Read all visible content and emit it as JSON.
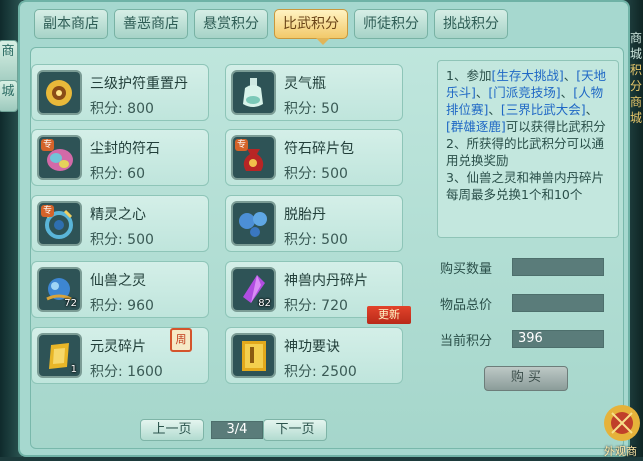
{
  "side_left": {
    "glyph_top": "商",
    "glyph_bottom": "城"
  },
  "side_right": {
    "glyphs": [
      "商",
      "城",
      "积",
      "分",
      "商",
      "城"
    ]
  },
  "tabs": [
    {
      "label": "副本商店",
      "active": false
    },
    {
      "label": "善恶商店",
      "active": false
    },
    {
      "label": "悬赏积分",
      "active": false
    },
    {
      "label": "比武积分",
      "active": true
    },
    {
      "label": "师徒积分",
      "active": false
    },
    {
      "label": "挑战积分",
      "active": false
    }
  ],
  "items": [
    {
      "name": "三级护符重置丹",
      "price": "积分: 800",
      "icon": "amulet-reset-pill-icon"
    },
    {
      "name": "灵气瓶",
      "price": "积分: 50",
      "icon": "spirit-bottle-icon"
    },
    {
      "name": "尘封的符石",
      "price": "积分: 60",
      "icon": "sealed-runestone-icon",
      "badge": "专"
    },
    {
      "name": "符石碎片包",
      "price": "积分: 500",
      "icon": "runestone-fragment-bag-icon",
      "badge": "专"
    },
    {
      "name": "精灵之心",
      "price": "积分: 500",
      "icon": "spirit-heart-icon",
      "badge": "专"
    },
    {
      "name": "脱胎丹",
      "price": "积分: 500",
      "icon": "rebirth-pill-icon"
    },
    {
      "name": "仙兽之灵",
      "price": "积分: 960",
      "icon": "beast-spirit-icon",
      "count": "72"
    },
    {
      "name": "神兽内丹碎片",
      "price": "积分: 720",
      "icon": "beast-core-fragment-icon",
      "count": "82"
    },
    {
      "name": "元灵碎片",
      "price": "积分: 1600",
      "icon": "yuanling-fragment-icon",
      "count": "1"
    },
    {
      "name": "神功要诀",
      "price": "积分: 2500",
      "icon": "skill-book-icon"
    }
  ],
  "tags": {
    "weekly": "周",
    "new": "更新"
  },
  "info": {
    "p1": "1、参加",
    "l1": "[生存大挑战]",
    "s1": "、",
    "l2": "[天地乐斗]",
    "s2": "、",
    "l3": "[门派竞技场]",
    "s3": "、",
    "l4": "[人物排位赛]",
    "s4": "、",
    "l5": "[三界比武大会]",
    "s5": "、",
    "l6": "[群雄逐鹿]",
    "p2": "可以获得比武积分",
    "line2": "2、所获得的比武积分可以通用兑换奖励",
    "line3": "3、仙兽之灵和神兽内丹碎片每周最多兑换1个和10个"
  },
  "form": {
    "qty_label": "购买数量",
    "qty_value": "",
    "total_label": "物品总价",
    "total_value": "",
    "current_label": "当前积分",
    "current_value": "396"
  },
  "buy_label": "购 买",
  "pager": {
    "prev": "上一页",
    "page": "3/4",
    "next": "下一页"
  },
  "corner_text": "外观商"
}
